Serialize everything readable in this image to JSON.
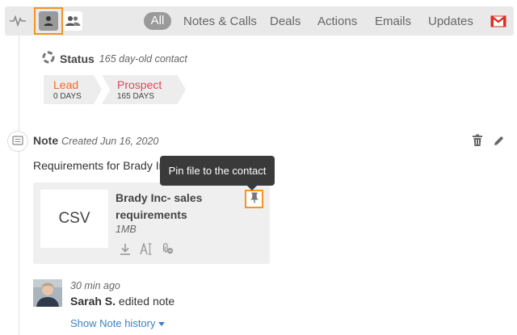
{
  "toolbar": {
    "icons": {
      "activity": "activity-icon",
      "person": "person-icon",
      "group": "group-icon",
      "gmail": "gmail-icon"
    },
    "tabs": [
      {
        "label": "All",
        "active": true
      },
      {
        "label": "Notes & Calls",
        "active": false
      },
      {
        "label": "Deals",
        "active": false
      },
      {
        "label": "Actions",
        "active": false
      },
      {
        "label": "Emails",
        "active": false
      },
      {
        "label": "Updates",
        "active": false
      }
    ]
  },
  "status": {
    "title": "Status",
    "subtitle": "165 day-old contact",
    "stages": [
      {
        "name": "Lead",
        "days": "0 DAYS",
        "color": "#f26b2a"
      },
      {
        "name": "Prospect",
        "days": "165 DAYS",
        "color": "#e0455c"
      }
    ]
  },
  "note": {
    "title": "Note",
    "created": "Created Jun 16, 2020",
    "body": "Requirements for Brady Inc",
    "file": {
      "type_label": "CSV",
      "name": "Brady Inc- sales requirements",
      "size": "1MB"
    },
    "tooltip": "Pin file to the contact"
  },
  "history": {
    "time": "30 min ago",
    "user": "Sarah S.",
    "action": " edited note",
    "show_link": "Show Note history"
  },
  "colors": {
    "accent_orange": "#f7931e",
    "link_blue": "#3b82c4",
    "lead": "#f26b2a",
    "prospect": "#e0455c"
  }
}
